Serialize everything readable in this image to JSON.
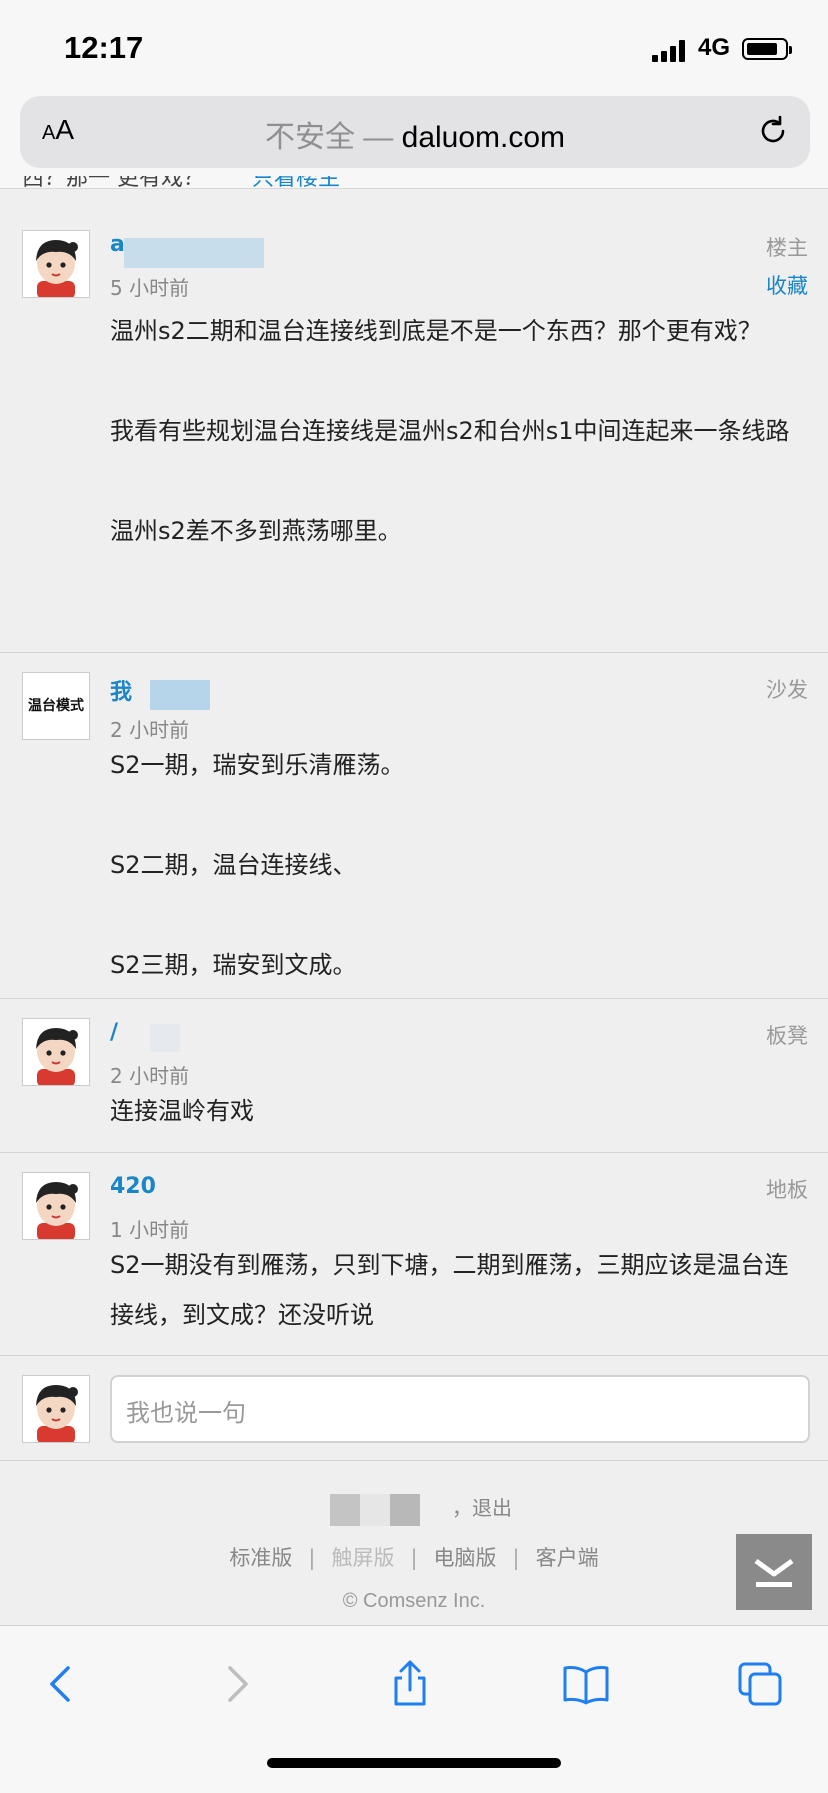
{
  "status_bar": {
    "time": "12:17",
    "network": "4G",
    "battery_level": 0.8
  },
  "address_bar": {
    "text_size_label_small": "A",
    "text_size_label_large": "A",
    "insecure_label": "不安全 —",
    "domain": "daluom.com"
  },
  "thread": {
    "title_fragment": "西？那一 更有戏？",
    "only_op_link": "只看楼主"
  },
  "posts": [
    {
      "username": "a",
      "time": "5 小时前",
      "floor": "楼主",
      "favorite": "收藏",
      "content": "温州s2二期和温台连接线到底是不是一个东西？那个更有戏？\n\n我看有些规划温台连接线是温州s2和台州s1中间连起来一条线路\n\n温州s2差不多到燕荡哪里。"
    },
    {
      "username": "我",
      "avatar_text": "温台模式",
      "time": "2 小时前",
      "floor": "沙发",
      "content": "S2一期，瑞安到乐清雁荡。\n\nS2二期，温台连接线、\n\nS2三期，瑞安到文成。"
    },
    {
      "username": "/",
      "time": "2 小时前",
      "floor": "板凳",
      "content": "连接温岭有戏"
    },
    {
      "username": "420",
      "time": "1 小时前",
      "floor": "地板",
      "content": "S2一期没有到雁荡，只到下塘，二期到雁荡，三期应该是温台连接线，到文成？还没听说"
    }
  ],
  "reply_box": {
    "placeholder": "我也说一句"
  },
  "footer": {
    "logout_text": "，退出",
    "links": [
      "标准版",
      "触屏版",
      "电脑版",
      "客户端"
    ],
    "separator": "|",
    "copyright": "© Comsenz Inc."
  },
  "colors": {
    "link_blue": "#1a86c8",
    "page_bg": "#efefef",
    "ios_blue": "#1f7ff0"
  },
  "toolbar_icons": [
    "back-icon",
    "forward-icon",
    "share-icon",
    "bookmarks-icon",
    "tabs-icon"
  ]
}
